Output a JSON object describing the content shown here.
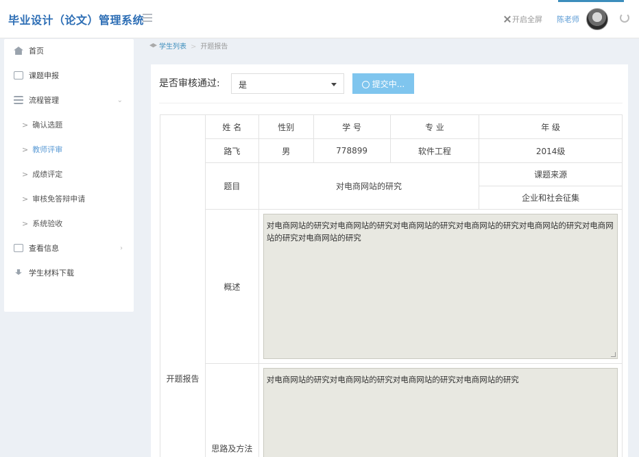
{
  "app": {
    "title": "毕业设计（论文）管理系统"
  },
  "header": {
    "fullscreen_label": "开启全屏",
    "user_name": "陈老师"
  },
  "sidebar": {
    "items": [
      {
        "label": "首页"
      },
      {
        "label": "课题申报"
      },
      {
        "label": "流程管理",
        "arrow": "⌄"
      },
      {
        "label": "查看信息",
        "arrow": "›"
      },
      {
        "label": "学生材料下载"
      }
    ],
    "subitems": [
      {
        "label": "确认选题"
      },
      {
        "label": "教师评审"
      },
      {
        "label": "成绩评定"
      },
      {
        "label": "审核免答辩申请"
      },
      {
        "label": "系统验收"
      }
    ],
    "active": "教师评审"
  },
  "breadcrumb": {
    "link": "学生列表",
    "current": "开题报告"
  },
  "review": {
    "label": "是否审核通过:",
    "selected": "是",
    "submit_label": "提交中..."
  },
  "report": {
    "section_label": "开题报告",
    "headers": {
      "name": "姓 名",
      "gender": "性别",
      "student_id": "学 号",
      "major": "专 业",
      "grade": "年 级"
    },
    "student": {
      "name": "路飞",
      "gender": "男",
      "student_id": "778899",
      "major": "软件工程",
      "grade": "2014级"
    },
    "topic_label": "题目",
    "topic": "对电商网站的研究",
    "source_label": "课题来源",
    "source": "企业和社会征集",
    "overview_label": "概述",
    "overview": "对电商网站的研究对电商网站的研究对电商网站的研究对电商网站的研究对电商网站的研究对电商网站的研究对电商网站的研究",
    "method_label": "思路及方法",
    "method": "对电商网站的研究对电商网站的研究对电商网站的研究对电商网站的研究"
  },
  "colors": {
    "brand": "#2d6eb5",
    "link": "#3c8dbc",
    "submit": "#7fc5ee",
    "active": "#5b9bd5"
  },
  "icons": [
    "menu-icon",
    "fullscreen-icon",
    "logout-icon",
    "home-icon",
    "checkbox-icon",
    "list-icon",
    "info-icon",
    "download-icon",
    "breadcrumb-icon",
    "spinner-icon"
  ]
}
